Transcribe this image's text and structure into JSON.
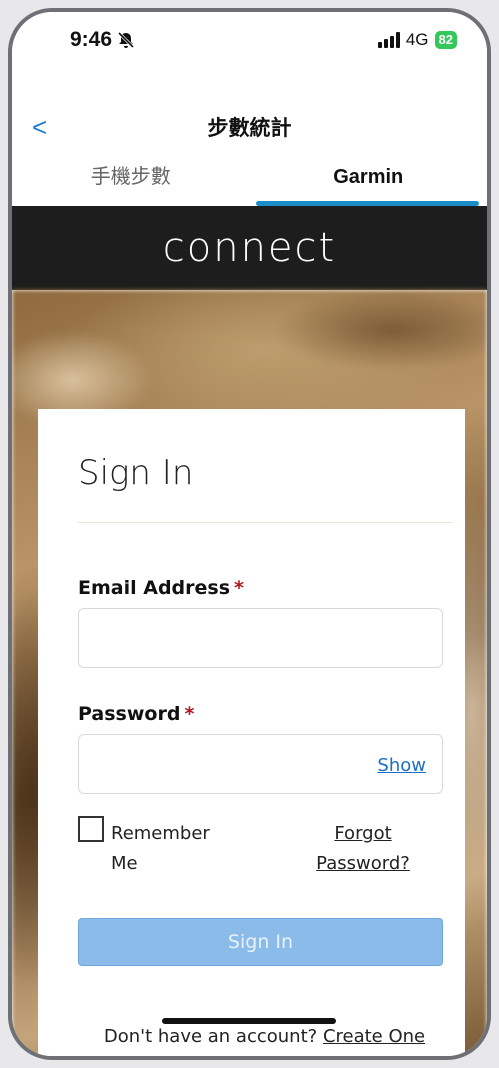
{
  "status": {
    "time": "9:46",
    "network": "4G",
    "battery": "82"
  },
  "header": {
    "back": "<",
    "title": "步數統計"
  },
  "tabs": [
    {
      "label": "手機步數",
      "active": false
    },
    {
      "label": "Garmin",
      "active": true
    }
  ],
  "banner": {
    "logo": "connect"
  },
  "signin": {
    "title": "Sign In",
    "email_label": "Email Address",
    "required_mark": "*",
    "email_value": "",
    "password_label": "Password",
    "password_value": "",
    "show_label": "Show",
    "remember_label": "Remember Me",
    "forgot_label": "Forgot Password?",
    "button_label": "Sign In",
    "no_account_text": "Don't have an account?",
    "create_label": "Create One"
  },
  "colors": {
    "accent": "#1b8ec9",
    "button": "#8bbce9",
    "required": "#b0171f",
    "battery": "#34c759"
  }
}
